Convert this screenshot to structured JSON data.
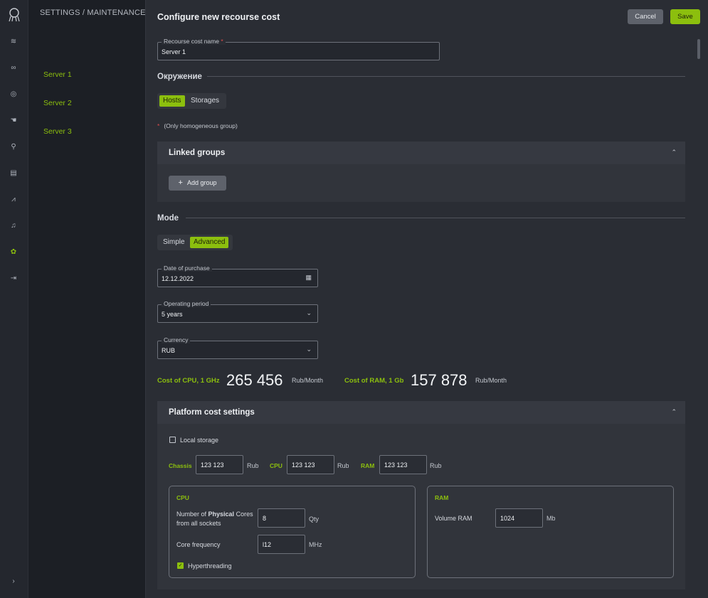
{
  "breadcrumb": "SETTINGS  /  MAINTENANCE  /",
  "servers": [
    "Server 1",
    "Server 2",
    "Server 3"
  ],
  "rail_icons": [
    "layers-icon",
    "nodes-icon",
    "radar-icon",
    "hand-icon",
    "search-icon",
    "document-icon",
    "chart-icon",
    "bell-icon",
    "settings-icon",
    "logout-icon"
  ],
  "rail_expand": "›",
  "accent_color": "#8cbf0e",
  "panel": {
    "title": "Configure new recourse cost",
    "cancel_label": "Cancel",
    "save_label": "Save",
    "name_field": {
      "label": "Recourse cost name",
      "required_mark": "*",
      "value": "Server 1"
    },
    "environment": {
      "heading": "Окружение",
      "options": [
        "Hosts",
        "Storages"
      ],
      "selected": "Hosts",
      "required_mark": "*",
      "note": "(Only homogeneous group)"
    },
    "linked_groups": {
      "title": "Linked groups",
      "add_label": "Add group"
    },
    "mode": {
      "heading": "Mode",
      "options": [
        "Simple",
        "Advanced"
      ],
      "selected": "Advanced"
    },
    "date_of_purchase": {
      "label": "Date of purchase",
      "value": "12.12.2022"
    },
    "operating_period": {
      "label": "Operating period",
      "value": "5 years"
    },
    "currency": {
      "label": "Currency",
      "value": "RUB"
    },
    "cost_cpu": {
      "label": "Cost of CPU, 1 GHz",
      "value": "265 456",
      "unit": "Rub/Month"
    },
    "cost_ram": {
      "label": "Cost of RAM, 1 Gb",
      "value": "157 878",
      "unit": "Rub/Month"
    },
    "platform": {
      "title": "Platform cost settings",
      "local_storage_label": "Local storage",
      "local_storage_checked": false,
      "chassis": {
        "label": "Chassis",
        "value": "123 123",
        "unit": "Rub"
      },
      "cpu": {
        "label": "CPU",
        "value": "123 123",
        "unit": "Rub"
      },
      "ram": {
        "label": "RAM",
        "value": "123 123",
        "unit": "Rub"
      },
      "cpu_box": {
        "title": "CPU",
        "cores_label_pre": "Number of ",
        "cores_label_bold": "Physical",
        "cores_label_post": " Cores",
        "cores_label_line2": "from all sockets",
        "cores_value": "8",
        "cores_unit": "Qty",
        "freq_label": "Core frequency",
        "freq_value": "l12",
        "freq_unit": "MHz",
        "hyperthreading_label": "Hyperthreading",
        "hyperthreading_checked": true
      },
      "ram_box": {
        "title": "RAM",
        "volume_label": "Volume RAM",
        "volume_value": "1024",
        "volume_unit": "Mb"
      }
    }
  }
}
